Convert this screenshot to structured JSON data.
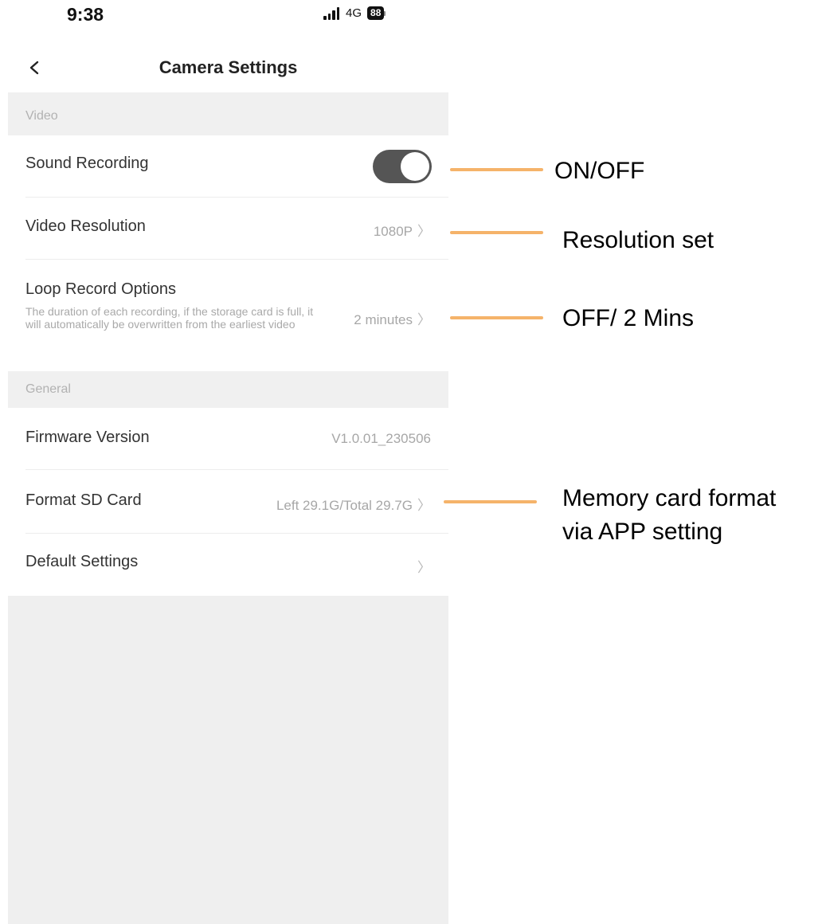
{
  "status_bar": {
    "time": "9:38",
    "network": "4G",
    "battery": "88"
  },
  "header": {
    "title": "Camera Settings"
  },
  "sections": {
    "video": {
      "title": "Video",
      "sound_recording": {
        "label": "Sound Recording",
        "enabled": true
      },
      "video_resolution": {
        "label": "Video Resolution",
        "value": "1080P"
      },
      "loop_record": {
        "label": "Loop Record Options",
        "description": "The duration of each recording, if the storage card is full, it will automatically be overwritten from the earliest video",
        "value": "2 minutes"
      }
    },
    "general": {
      "title": "General",
      "firmware": {
        "label": "Firmware Version",
        "value": "V1.0.01_230506"
      },
      "format_sd": {
        "label": "Format SD Card",
        "value": "Left 29.1G/Total 29.7G"
      },
      "default_settings": {
        "label": "Default Settings"
      }
    }
  },
  "annotations": {
    "sound": "ON/OFF",
    "resolution": "Resolution set",
    "loop": "OFF/ 2 Mins",
    "format_line1": "Memory card format",
    "format_line2": "via APP setting"
  },
  "colors": {
    "annotation_line": "#f5b36a",
    "toggle_on": "#555555",
    "section_bg": "#f0f0f0"
  },
  "icons": {
    "back": "chevron-left-icon",
    "row_arrow": "chevron-right-icon"
  }
}
